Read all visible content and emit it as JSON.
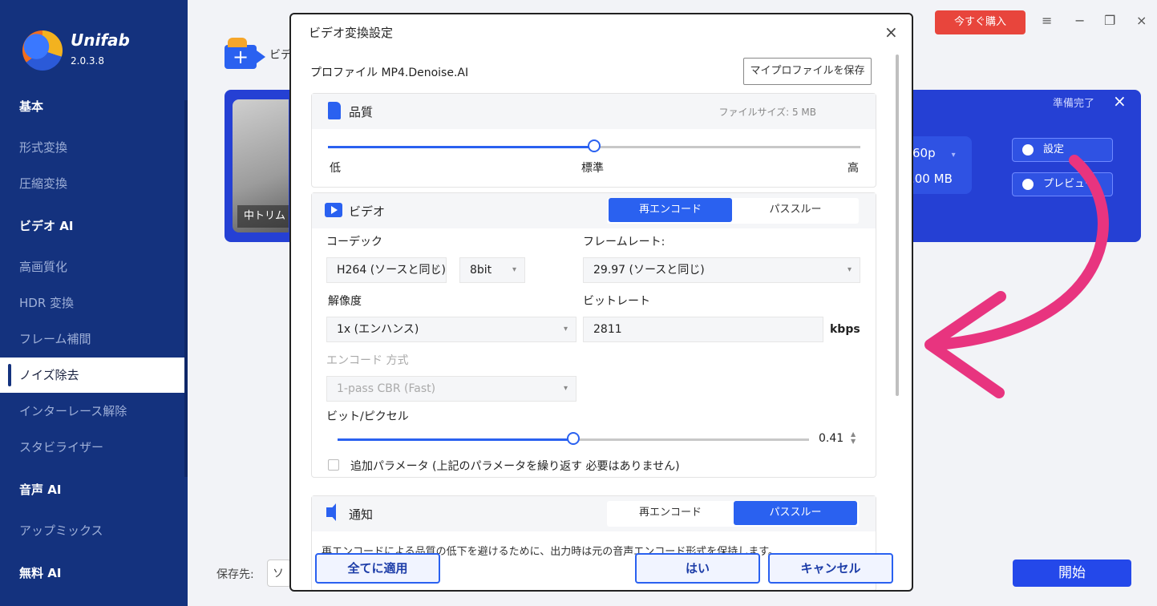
{
  "app": {
    "name": "Unifab",
    "version": "2.0.3.8"
  },
  "sidebar": {
    "items": [
      {
        "label": "基本",
        "type": "header"
      },
      {
        "label": "形式変換",
        "type": "item"
      },
      {
        "label": "圧縮変換",
        "type": "item"
      },
      {
        "label": "ビデオ AI",
        "type": "header"
      },
      {
        "label": "高画質化",
        "type": "item"
      },
      {
        "label": "HDR 変換",
        "type": "item"
      },
      {
        "label": "フレーム補間",
        "type": "item"
      },
      {
        "label": "ノイズ除去",
        "type": "active"
      },
      {
        "label": "インターレース解除",
        "type": "item"
      },
      {
        "label": "スタビライザー",
        "type": "item"
      },
      {
        "label": "音声 AI",
        "type": "header"
      },
      {
        "label": "アップミックス",
        "type": "item"
      },
      {
        "label": "無料 AI",
        "type": "header"
      }
    ]
  },
  "topbar": {
    "buy_label": "今すぐ購入",
    "menu_icon": "≡",
    "min_icon": "−",
    "max_icon": "❐",
    "close_icon": "×"
  },
  "main": {
    "add_label": "ビデ",
    "card": {
      "trim_label": "中トリム",
      "status": "準備完了",
      "close": "×",
      "resolution": "60p",
      "size": ".00 MB",
      "settings_label": "設定",
      "preview_label": "プレビュー"
    },
    "save_to_label": "保存先:",
    "save_to_value": "ソー",
    "start_label": "開始"
  },
  "dialog": {
    "title": "ビデオ変換設定",
    "close": "×",
    "profile": "プロファイル  MP4.Denoise.AI",
    "save_profile_label": "マイプロファイルを保存",
    "quality": {
      "title": "品質",
      "file_size": "ファイルサイズ:  5 MB",
      "low": "低",
      "standard": "標準",
      "high": "高",
      "level": 0.5
    },
    "video": {
      "title": "ビデオ",
      "tab_reencode": "再エンコード",
      "tab_passthrough": "パススルー",
      "codec_label": "コーデック",
      "codec_value": "H264 (ソースと同じ)",
      "bitdepth_value": "8bit",
      "framerate_label": "フレームレート:",
      "framerate_value": "29.97 (ソースと同じ)",
      "resolution_label": "解像度",
      "resolution_value": "1x (エンハンス)",
      "bitrate_label": "ビットレート",
      "bitrate_value": "2811",
      "bitrate_unit": "kbps",
      "encode_mode_label": "エンコード 方式",
      "encode_mode_value": "1-pass CBR (Fast)",
      "bpp_label": "ビット/ピクセル",
      "bpp_value": "0.41",
      "bpp_level": 0.5,
      "extra_param": "追加パラメータ (上記のパラメータを繰り返す 必要はありません)"
    },
    "audio": {
      "title": "通知",
      "tab_reencode": "再エンコード",
      "tab_passthrough": "パススルー",
      "note": "再エンコードによる品質の低下を避けるために、出力時は元の音声エンコード形式を保持します。"
    },
    "apply_all_label": "全てに適用",
    "yes_label": "はい",
    "cancel_label": "キャンセル"
  },
  "colors": {
    "sidebar": "#14327e",
    "accent": "#2a61f0",
    "card": "#2540d4",
    "buy": "#e8453c",
    "arrow": "#e8347f"
  }
}
